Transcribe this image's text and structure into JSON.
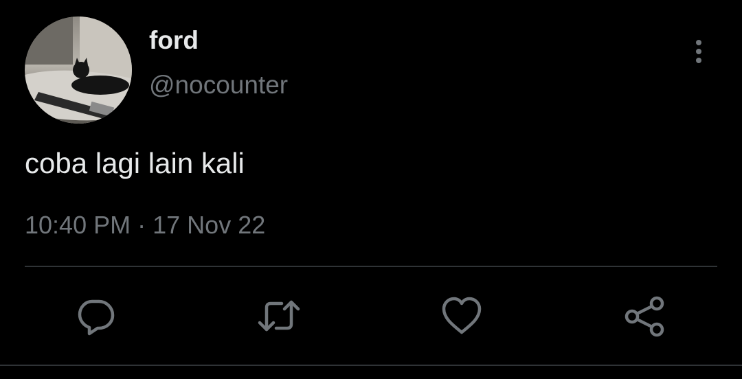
{
  "tweet": {
    "author": {
      "display_name": "ford",
      "handle": "@nocounter",
      "avatar_icon": "avatar-photo-cat-guitar"
    },
    "text": "coba lagi lain kali",
    "time": "10:40 PM",
    "separator": "·",
    "date": "17 Nov 22"
  },
  "actions": [
    {
      "name": "reply",
      "icon": "speech-bubble-icon"
    },
    {
      "name": "retweet",
      "icon": "retweet-icon"
    },
    {
      "name": "like",
      "icon": "heart-icon"
    },
    {
      "name": "share",
      "icon": "share-icon"
    }
  ],
  "menu": {
    "icon": "vertical-dots-icon"
  },
  "colors": {
    "background": "#000000",
    "primary_text": "#e7e9ea",
    "secondary_text": "#71767b",
    "divider": "#2f3336",
    "icon": "#71767b"
  }
}
